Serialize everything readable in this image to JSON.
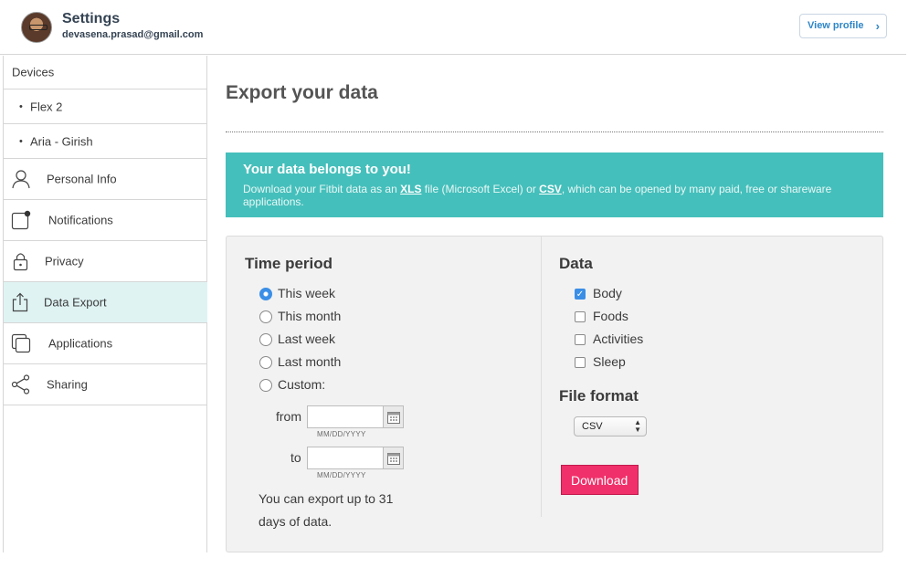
{
  "header": {
    "title": "Settings",
    "email": "devasena.prasad@gmail.com",
    "view_profile": "View profile"
  },
  "sidebar": {
    "devices_heading": "Devices",
    "devices": [
      "Flex 2",
      "Aria - Girish"
    ],
    "items": [
      {
        "label": "Personal Info",
        "icon": "person-icon"
      },
      {
        "label": "Notifications",
        "icon": "notification-icon"
      },
      {
        "label": "Privacy",
        "icon": "lock-icon"
      },
      {
        "label": "Data Export",
        "icon": "export-icon",
        "active": true
      },
      {
        "label": "Applications",
        "icon": "applications-icon"
      },
      {
        "label": "Sharing",
        "icon": "share-icon"
      }
    ]
  },
  "main": {
    "title": "Export your data",
    "banner": {
      "title": "Your data belongs to you!",
      "text_before": "Download your Fitbit data as an ",
      "xls": "XLS",
      "text_middle": " file (Microsoft Excel) or ",
      "csv": "CSV",
      "text_after": ", which can be opened by many paid, free or shareware applications."
    },
    "time_period": {
      "title": "Time period",
      "options": [
        "This week",
        "This month",
        "Last week",
        "Last month",
        "Custom:"
      ],
      "selected": "This week",
      "from_label": "from",
      "to_label": "to",
      "date_placeholder": "MM/DD/YYYY",
      "note": "You can export up to 31 days of data."
    },
    "data": {
      "title": "Data",
      "options": [
        {
          "label": "Body",
          "checked": true
        },
        {
          "label": "Foods",
          "checked": false
        },
        {
          "label": "Activities",
          "checked": false
        },
        {
          "label": "Sleep",
          "checked": false
        }
      ]
    },
    "file_format": {
      "title": "File format",
      "value": "CSV"
    },
    "download_label": "Download"
  },
  "colors": {
    "banner": "#45bfbb",
    "accent": "#3a8ee6",
    "download": "#f0306a",
    "active_nav": "#dff3f3"
  }
}
